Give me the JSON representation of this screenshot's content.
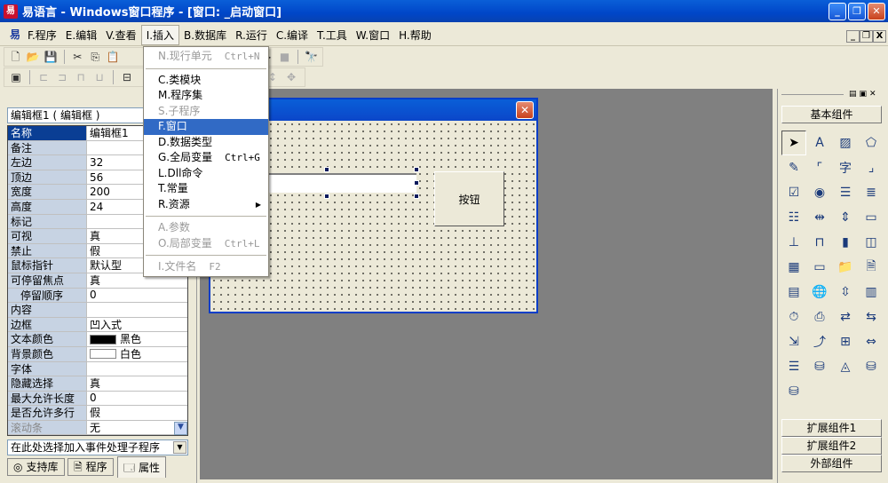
{
  "title": "易语言 - Windows窗口程序 - [窗口: _启动窗口]",
  "menubar": [
    "F.程序",
    "E.编辑",
    "V.查看",
    "I.插入",
    "B.数据库",
    "R.运行",
    "C.编译",
    "T.工具",
    "W.窗口",
    "H.帮助"
  ],
  "insert_menu": [
    {
      "label": "N.现行单元",
      "shortcut": "Ctrl+N",
      "disabled": true
    },
    {
      "sep": true
    },
    {
      "label": "C.类模块"
    },
    {
      "label": "M.程序集"
    },
    {
      "label": "S.子程序",
      "disabled": true
    },
    {
      "label": "F.窗口",
      "highlight": true
    },
    {
      "label": "D.数据类型"
    },
    {
      "label": "G.全局变量",
      "shortcut": "Ctrl+G"
    },
    {
      "label": "L.Dll命令"
    },
    {
      "label": "T.常量"
    },
    {
      "label": "R.资源",
      "submenu": true
    },
    {
      "sep": true
    },
    {
      "label": "A.参数",
      "disabled": true
    },
    {
      "label": "O.局部变量",
      "shortcut": "Ctrl+L",
      "disabled": true
    },
    {
      "sep": true
    },
    {
      "label": "I.文件名",
      "shortcut": "F2",
      "disabled": true
    }
  ],
  "left": {
    "object_selector": "编辑框1 ( 编辑框 )",
    "properties": [
      [
        "名称",
        "编辑框1"
      ],
      [
        "备注",
        ""
      ],
      [
        "左边",
        "32"
      ],
      [
        "顶边",
        "56"
      ],
      [
        "宽度",
        "200"
      ],
      [
        "高度",
        "24"
      ],
      [
        "标记",
        ""
      ],
      [
        "可视",
        "真"
      ],
      [
        "禁止",
        "假"
      ],
      [
        "鼠标指针",
        "默认型"
      ],
      [
        "可停留焦点",
        "真"
      ],
      [
        "停留顺序",
        "0"
      ],
      [
        "内容",
        ""
      ],
      [
        "边框",
        "凹入式"
      ],
      [
        "文本颜色",
        "黑色"
      ],
      [
        "背景颜色",
        "白色"
      ],
      [
        "字体",
        ""
      ],
      [
        "隐藏选择",
        "真"
      ],
      [
        "最大允许长度",
        "0"
      ],
      [
        "是否允许多行",
        "假"
      ],
      [
        "滚动条",
        "无"
      ]
    ],
    "event_selector": "在此处选择加入事件处理子程序",
    "tabs": [
      "支持库",
      "程序",
      "属性"
    ]
  },
  "design": {
    "button_label": "按钮"
  },
  "right": {
    "top_button": "基本组件",
    "bottom_buttons": [
      "扩展组件1",
      "扩展组件2",
      "外部组件"
    ]
  },
  "colors": {
    "title": "#0a5fd8",
    "highlight": "#316ac5",
    "prop_key": "#c7d3e3"
  }
}
